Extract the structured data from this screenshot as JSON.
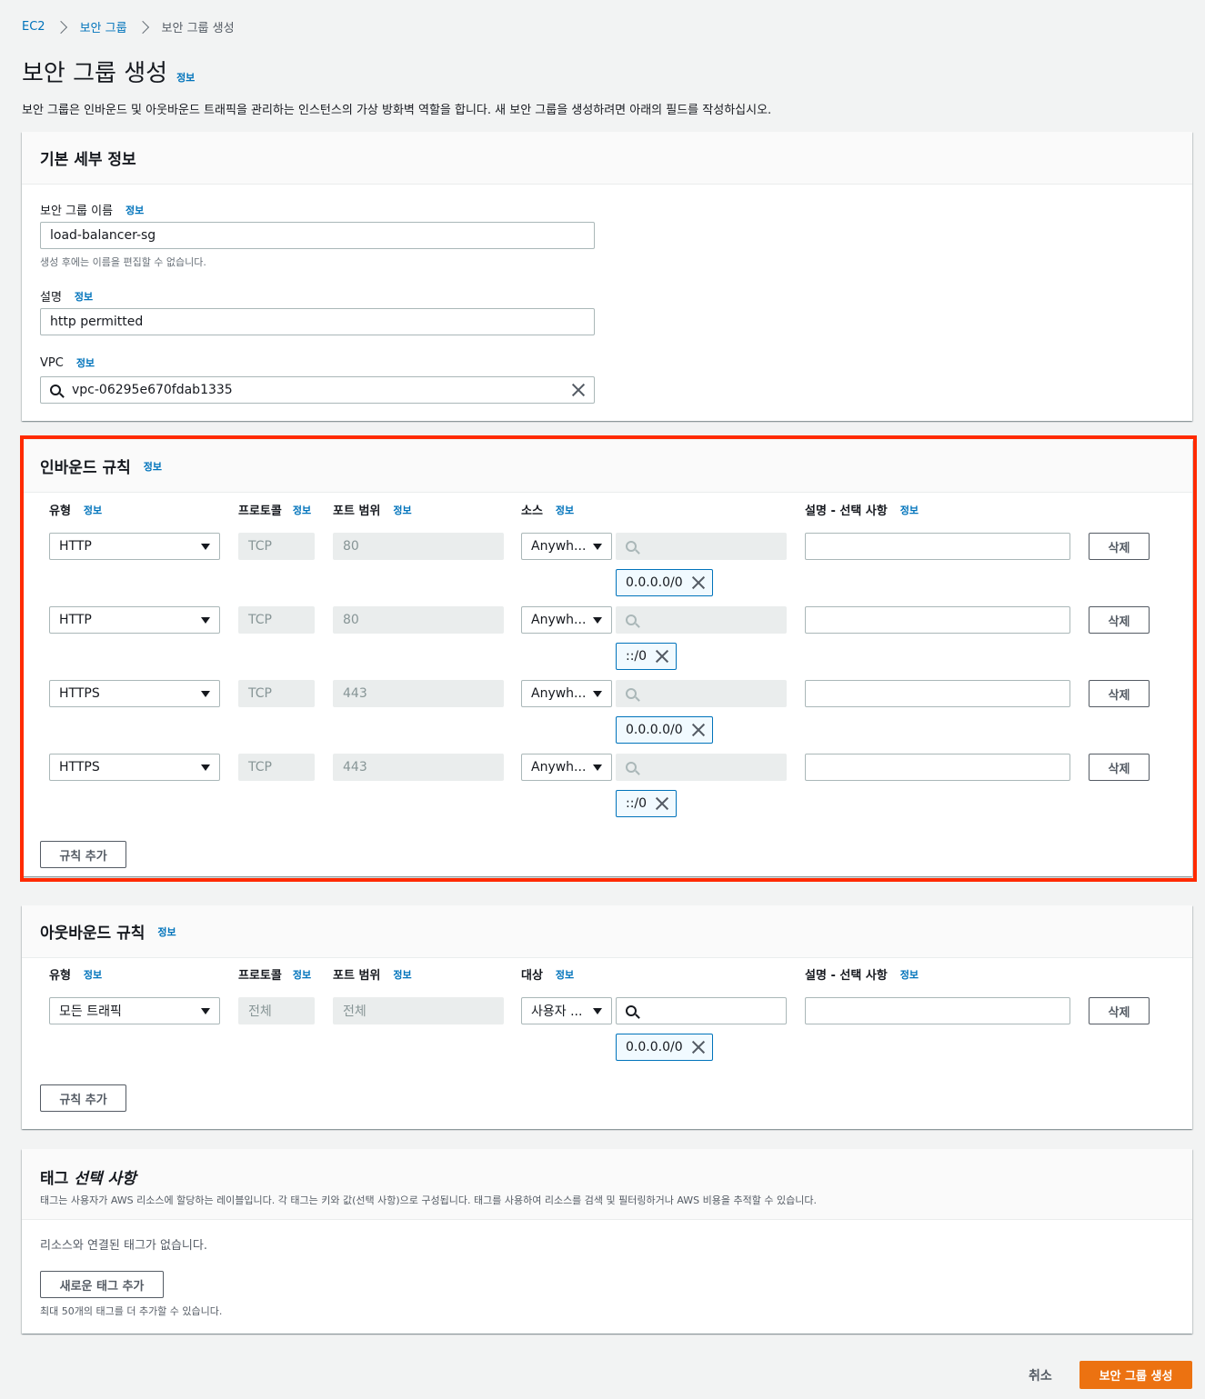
{
  "breadcrumb": {
    "root": "EC2",
    "parent": "보안 그룹",
    "current": "보안 그룹 생성"
  },
  "page": {
    "title": "보안 그룹 생성",
    "info": "정보",
    "description": "보안 그룹은 인바운드 및 아웃바운드 트래픽을 관리하는 인스턴스의 가상 방화벽 역할을 합니다. 새 보안 그룹을 생성하려면 아래의 필드를 작성하십시오."
  },
  "basic": {
    "title": "기본 세부 정보",
    "name_label": "보안 그룹 이름",
    "name_value": "load-balancer-sg",
    "name_hint": "생성 후에는 이름을 편집할 수 없습니다.",
    "desc_label": "설명",
    "desc_value": "http permitted",
    "vpc_label": "VPC",
    "vpc_value": "vpc-06295e670fdab1335"
  },
  "inbound": {
    "title": "인바운드 규칙",
    "col_type": "유형",
    "col_protocol": "프로토콜",
    "col_port": "포트 범위",
    "col_source": "소스",
    "col_desc": "설명 - 선택 사항",
    "rows": [
      {
        "type": "HTTP",
        "protocol": "TCP",
        "port": "80",
        "source": "Anywh...",
        "cidr": "0.0.0.0/0",
        "delete": "삭제"
      },
      {
        "type": "HTTP",
        "protocol": "TCP",
        "port": "80",
        "source": "Anywh...",
        "cidr": "::/0",
        "delete": "삭제"
      },
      {
        "type": "HTTPS",
        "protocol": "TCP",
        "port": "443",
        "source": "Anywh...",
        "cidr": "0.0.0.0/0",
        "delete": "삭제"
      },
      {
        "type": "HTTPS",
        "protocol": "TCP",
        "port": "443",
        "source": "Anywh...",
        "cidr": "::/0",
        "delete": "삭제"
      }
    ],
    "add_rule": "규칙 추가",
    "highlight_color": "#ff2a00"
  },
  "outbound": {
    "title": "아웃바운드 규칙",
    "col_type": "유형",
    "col_protocol": "프로토콜",
    "col_port": "포트 범위",
    "col_dest": "대상",
    "col_desc": "설명 - 선택 사항",
    "row": {
      "type": "모든 트래픽",
      "protocol": "전체",
      "port": "전체",
      "dest": "사용자 ...",
      "cidr": "0.0.0.0/0",
      "delete": "삭제"
    },
    "add_rule": "규칙 추가"
  },
  "tags": {
    "title_main": "태그 ",
    "title_optional": "선택 사항",
    "description": "태그는 사용자가 AWS 리소스에 할당하는 레이블입니다. 각 태그는 키와 값(선택 사항)으로 구성됩니다. 태그를 사용하여 리소스를 검색 및 필터링하거나 AWS 비용을 추적할 수 있습니다.",
    "empty": "리소스와 연결된 태그가 없습니다.",
    "add_tag": "새로운 태그 추가",
    "limit": "최대 50개의 태그를 더 추가할 수 있습니다."
  },
  "footer": {
    "cancel": "취소",
    "create": "보안 그룹 생성",
    "create_color": "#ec7211"
  }
}
